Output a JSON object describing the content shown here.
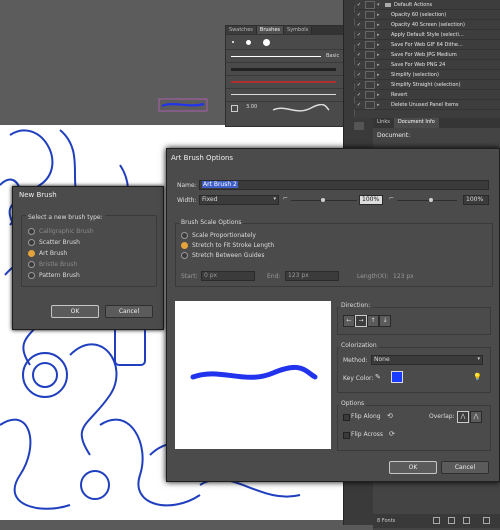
{
  "brushes_panel": {
    "tabs": [
      "Swatches",
      "Brushes",
      "Symbols"
    ],
    "basic_label": "Basic",
    "size_label": "3.00"
  },
  "actions_panel": {
    "items": [
      {
        "label": "Default Actions",
        "folder": true
      },
      {
        "label": "Opacity 60 (selection)"
      },
      {
        "label": "Opacity 40 Screen (selection)"
      },
      {
        "label": "Apply Default Style (selecti..."
      },
      {
        "label": "Save For Web GIF 64 Dithe..."
      },
      {
        "label": "Save For Web JPG Medium"
      },
      {
        "label": "Save For Web PNG 24"
      },
      {
        "label": "Simplify (selection)"
      },
      {
        "label": "Simplify Straight (selection)"
      },
      {
        "label": "Revert"
      },
      {
        "label": "Delete Unused Panel Items"
      }
    ]
  },
  "info_panel": {
    "tabs": [
      "Links",
      "Document Info"
    ],
    "heading": "Document:",
    "footer": "8 Fonts"
  },
  "new_brush": {
    "title": "New Brush",
    "prompt": "Select a new brush type:",
    "options": [
      {
        "label": "Calligraphic Brush",
        "enabled": false,
        "selected": false
      },
      {
        "label": "Scatter Brush",
        "enabled": true,
        "selected": false
      },
      {
        "label": "Art Brush",
        "enabled": true,
        "selected": true
      },
      {
        "label": "Bristle Brush",
        "enabled": false,
        "selected": false
      },
      {
        "label": "Pattern Brush",
        "enabled": true,
        "selected": false
      }
    ],
    "ok_label": "OK",
    "cancel_label": "Cancel"
  },
  "art_brush": {
    "title": "Art Brush Options",
    "name_label": "Name:",
    "name_value": "Art Brush 2",
    "width_label": "Width:",
    "width_value": "Fixed",
    "width_pct": "100%",
    "width_pct2": "100%",
    "scale_title": "Brush Scale Options",
    "scale_options": [
      {
        "label": "Scale Proportionately",
        "selected": false
      },
      {
        "label": "Stretch to Fit Stroke Length",
        "selected": true
      },
      {
        "label": "Stretch Between Guides",
        "selected": false
      }
    ],
    "start_label": "Start:",
    "start_value": "0 px",
    "end_label": "End:",
    "end_value": "123 px",
    "length_label": "Length(X):",
    "length_value": "123 px",
    "direction_title": "Direction:",
    "direction_buttons": [
      "←",
      "→",
      "↑",
      "↓"
    ],
    "colorization_title": "Colorization",
    "method_label": "Method:",
    "method_value": "None",
    "keycolor_label": "Key Color:",
    "keycolor": "#1a3cff",
    "options_title": "Options",
    "flip_along": "Flip Along",
    "flip_across": "Flip Across",
    "overlap_label": "Overlap:",
    "ok_label": "OK",
    "cancel_label": "Cancel",
    "stroke_color": "#2233ee"
  }
}
